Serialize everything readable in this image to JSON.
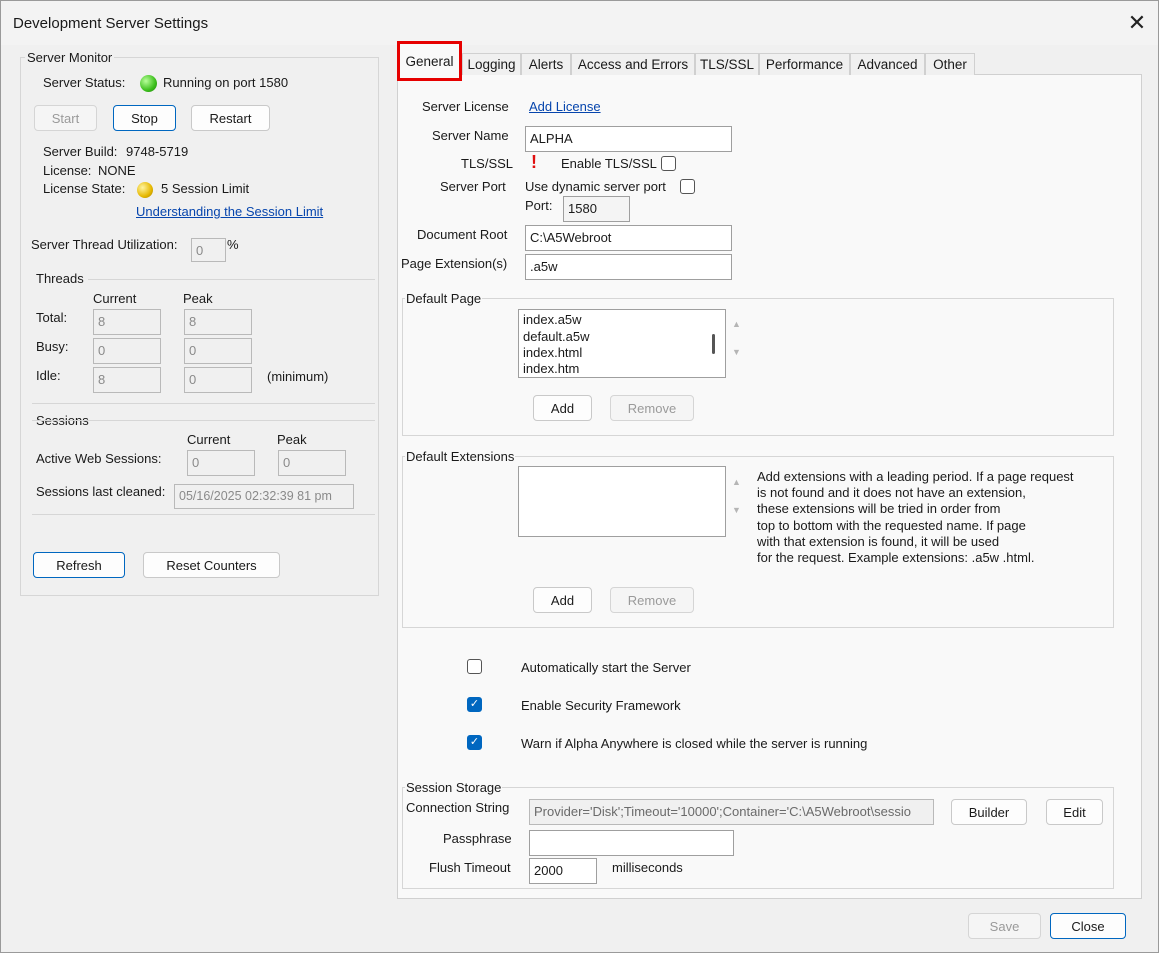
{
  "window": {
    "title": "Development Server Settings",
    "close_glyph": "✕"
  },
  "monitor": {
    "group_label": "Server Monitor",
    "status_label": "Server Status:",
    "status_value": "Running on port 1580",
    "status_color": "#3cbf1c",
    "buttons": {
      "start": "Start",
      "stop": "Stop",
      "restart": "Restart"
    },
    "build_label": "Server Build:",
    "build_value": "9748-5719",
    "license_label": "License:",
    "license_value": "NONE",
    "license_state_label": "License State:",
    "license_state_value": "5 Session Limit",
    "license_state_color": "#e6b800",
    "session_limit_link": "Understanding the Session Limit",
    "thread_util_label": "Server Thread Utilization:",
    "thread_util_value": "0",
    "thread_util_unit": "%",
    "threads": {
      "label": "Threads",
      "col_current": "Current",
      "col_peak": "Peak",
      "rows": [
        {
          "label": "Total:",
          "current": "8",
          "peak": "8",
          "note": ""
        },
        {
          "label": "Busy:",
          "current": "0",
          "peak": "0",
          "note": ""
        },
        {
          "label": "Idle:",
          "current": "8",
          "peak": "0",
          "note": "(minimum)"
        }
      ]
    },
    "sessions": {
      "label": "Sessions",
      "col_current": "Current",
      "col_peak": "Peak",
      "active_label": "Active Web Sessions:",
      "active_current": "0",
      "active_peak": "0",
      "cleaned_label": "Sessions last cleaned:",
      "cleaned_value": "05/16/2025 02:32:39 81 pm"
    },
    "refresh_label": "Refresh",
    "reset_label": "Reset Counters"
  },
  "tabs": [
    "General",
    "Logging",
    "Alerts",
    "Access and Errors",
    "TLS/SSL",
    "Performance",
    "Advanced",
    "Other"
  ],
  "general": {
    "license_label": "Server License",
    "add_license_link": "Add License",
    "server_name_label": "Server Name",
    "server_name_value": "ALPHA",
    "tls_label": "TLS/SSL",
    "tls_warning_glyph": "!",
    "enable_tls_label": "Enable TLS/SSL",
    "server_port_label": "Server Port",
    "dynamic_port_label": "Use dynamic server port",
    "port_label": "Port:",
    "port_value": "1580",
    "doc_root_label": "Document Root",
    "doc_root_value": "C:\\A5Webroot",
    "page_ext_label": "Page Extension(s)",
    "page_ext_value": ".a5w",
    "default_page": {
      "label": "Default Page",
      "items": [
        "index.a5w",
        "default.a5w",
        "index.html",
        "index.htm"
      ],
      "add_label": "Add",
      "remove_label": "Remove"
    },
    "default_ext": {
      "label": "Default Extensions",
      "help_lines": [
        "Add extensions with a leading period. If a page request",
        "is not found and it does not have an extension,",
        "these extensions will be tried in order from",
        "top to bottom with the requested name. If page",
        "with that extension is found, it will be used",
        "for the request. Example extensions: .a5w .html."
      ],
      "add_label": "Add",
      "remove_label": "Remove"
    },
    "options": [
      {
        "label": "Automatically start the Server",
        "checked": false
      },
      {
        "label": "Enable Security Framework",
        "checked": true
      },
      {
        "label": "Warn if Alpha Anywhere is closed while the server is running",
        "checked": true
      }
    ],
    "session_storage": {
      "label": "Session Storage",
      "conn_label": "Connection String",
      "conn_value": "Provider='Disk';Timeout='10000';Container='C:\\A5Webroot\\sessio",
      "builder_label": "Builder",
      "edit_label": "Edit",
      "pass_label": "Passphrase",
      "pass_value": "",
      "flush_label": "Flush Timeout",
      "flush_value": "2000",
      "flush_unit": "milliseconds"
    }
  },
  "footer": {
    "save_label": "Save",
    "close_label": "Close"
  },
  "colors": {
    "accent": "#0067c0",
    "highlight": "#e60000",
    "link": "#0645ad"
  },
  "icons": {
    "check": "✓",
    "up_arrow": "▲",
    "down_arrow": "▼"
  }
}
